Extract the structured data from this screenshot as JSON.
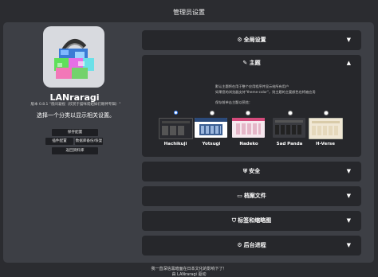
{
  "page_title": "管理员设置",
  "app": {
    "name": "LANraragi",
    "version": "版本 0.8.1 \"夜间凝视（欣赏于猫咪或姐妹们眼神专辑）\"",
    "tagline": "选择一个分类以显示相关设置。"
  },
  "buttons": {
    "save": "保存配置",
    "plugins": "插件配置",
    "backup": "数据库备份/恢复",
    "return": "返回资料库"
  },
  "sections": {
    "global": "全局设置",
    "theme": "主题",
    "security": "安全",
    "files": "档案文件",
    "tags": "标签和缩略图",
    "jobs": "后台进程"
  },
  "theme": {
    "desc1": "默认主题将在用于整个应用程序并显示给所有用户",
    "desc2": "如果您的浏览器支持\"theme-color\"，则主题的主要颜色也将被应用",
    "pick_label": "保存前单击主题以预览：",
    "options": [
      {
        "name": "Hachikuji",
        "selected": true
      },
      {
        "name": "Yotsugi",
        "selected": false
      },
      {
        "name": "Nadeko",
        "selected": false
      },
      {
        "name": "Sad Panda",
        "selected": false
      },
      {
        "name": "H-Verse",
        "selected": false
      }
    ]
  },
  "footer": {
    "line1": "我一直深信黑暗面在日本文化的影响下了！",
    "line2": "由 LANraragi 驱动"
  },
  "icons": {
    "global": "cogs-icon",
    "theme": "paintbrush-icon",
    "security": "shield-icon",
    "files": "archive-icon",
    "tags": "tags-icon",
    "jobs": "cog-icon",
    "collapsed": "caret-down-icon",
    "expanded": "caret-up-icon"
  },
  "colors": {
    "background": "#2b2c30",
    "panel": "#3d3f45",
    "section": "#26272b",
    "accent": "#3a86ff"
  }
}
